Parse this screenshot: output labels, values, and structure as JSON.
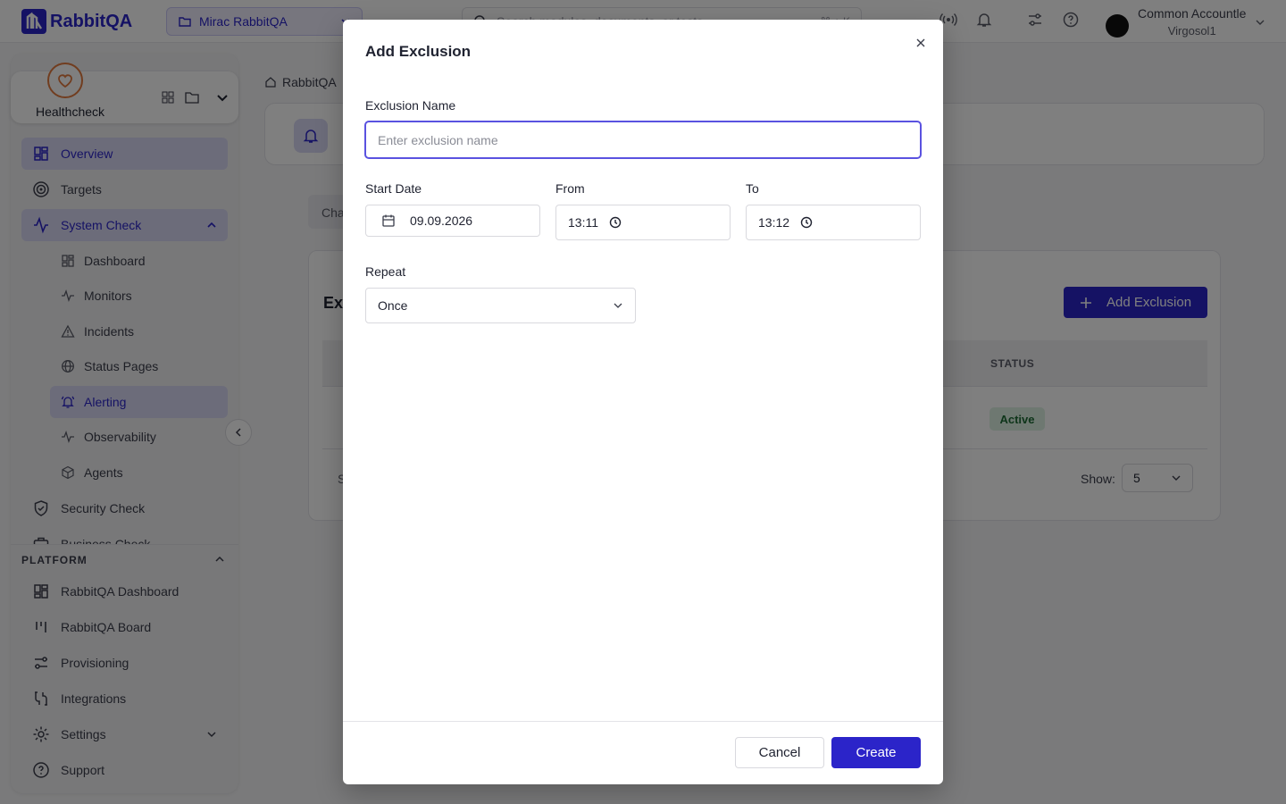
{
  "app": {
    "name": "RabbitQA"
  },
  "topbar": {
    "project": "Mirac RabbitQA",
    "search_placeholder": "Search modules, documents, or tests",
    "search_shortcut": "⌘ + K",
    "user_name": "Common Accountle",
    "user_org": "Virgosol1"
  },
  "sidebar": {
    "module": "Healthcheck",
    "items": [
      {
        "label": "Overview"
      },
      {
        "label": "Targets"
      },
      {
        "label": "System Check"
      },
      {
        "label": "Dashboard"
      },
      {
        "label": "Monitors"
      },
      {
        "label": "Incidents"
      },
      {
        "label": "Status Pages"
      },
      {
        "label": "Alerting"
      },
      {
        "label": "Observability"
      },
      {
        "label": "Agents"
      },
      {
        "label": "Security Check"
      },
      {
        "label": "Business Check"
      }
    ],
    "platform_label": "PLATFORM",
    "platform_items": [
      {
        "label": "RabbitQA Dashboard"
      },
      {
        "label": "RabbitQA Board"
      },
      {
        "label": "Provisioning"
      },
      {
        "label": "Integrations"
      },
      {
        "label": "Settings"
      },
      {
        "label": "Support"
      }
    ]
  },
  "main": {
    "breadcrumb_root": "RabbitQA",
    "tab_fragment": "Cha",
    "list_title_fragment": "Exc",
    "add_button": "Add Exclusion",
    "status_header": "STATUS",
    "row_status": "Active",
    "footer_fragment": "S",
    "show_label": "Show:",
    "show_value": "5"
  },
  "modal": {
    "title": "Add Exclusion",
    "name_label": "Exclusion Name",
    "name_placeholder": "Enter exclusion name",
    "start_label": "Start Date",
    "start_value": "09.09.2026",
    "from_label": "From",
    "from_value": "13:11",
    "to_label": "To",
    "to_value": "13:12",
    "repeat_label": "Repeat",
    "repeat_value": "Once",
    "cancel": "Cancel",
    "create": "Create"
  }
}
